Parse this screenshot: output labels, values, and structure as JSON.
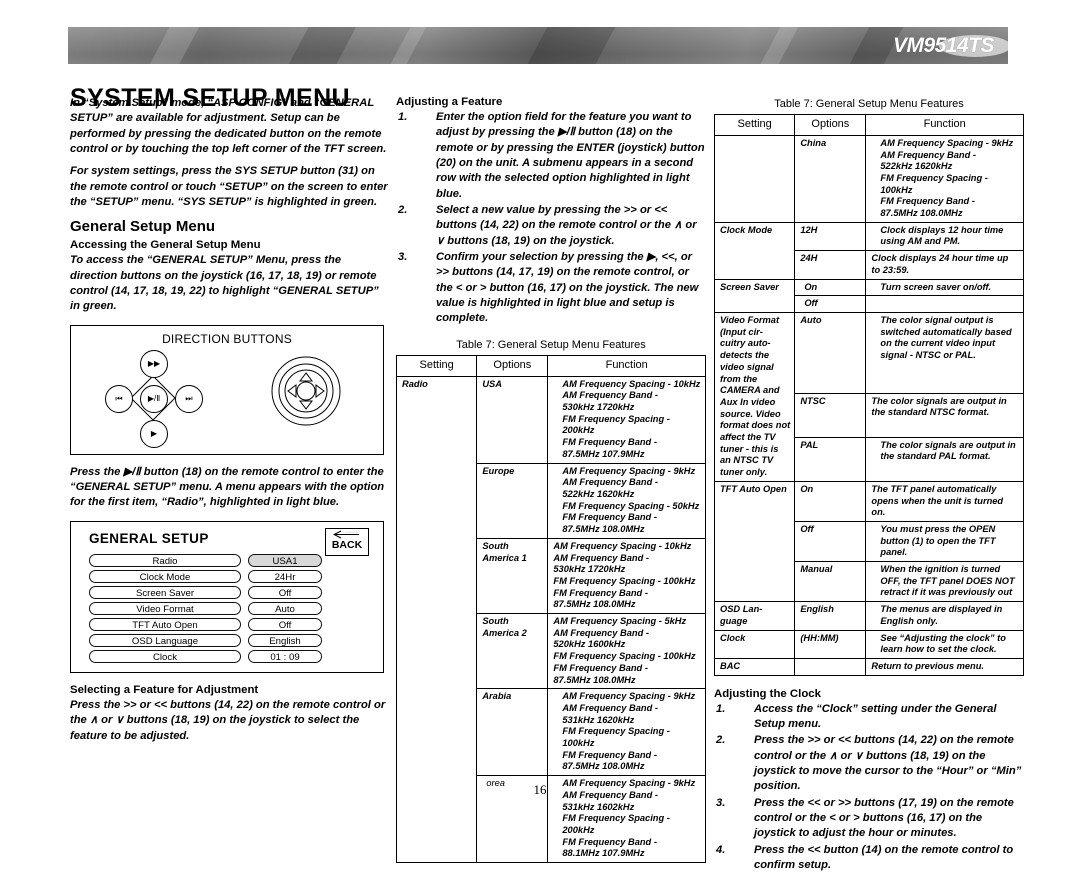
{
  "header": {
    "logo": "VM9514TS",
    "title": "SYSTEM SETUP MENU"
  },
  "left_column": {
    "intro_p1": "In “System Setup” mode, “ASP CONFIG” and “GENERAL SETUP” are available for adjustment. Setup can be performed by pressing the dedicated button on the remote control or by touching the top left corner of the TFT screen.",
    "intro_p2": "For system settings, press the SYS SETUP button (31) on the remote control or touch “SETUP” on the screen to enter the “SETUP” menu. “SYS SETUP” is highlighted in green.",
    "section_heading": "General Setup Menu",
    "accessing_heading": "Accessing the General Setup Menu",
    "accessing_body": "To access the “GENERAL SETUP” Menu, press the direction buttons on the joystick (16, 17, 18, 19) or remote control (14, 17, 18, 19, 22) to highlight “GENERAL SETUP” in green.",
    "figure_direction_caption": "DIRECTION BUTTONS",
    "dpad": {
      "up": "▶▶",
      "left": "⏮",
      "center": "▶/Ⅱ",
      "right": "⏭",
      "down": "▶"
    },
    "press_enter_body": "Press the ▶/Ⅱ button (18) on the remote control to enter the “GENERAL SETUP” menu. A menu appears with the option for the first item, “Radio”, highlighted in light blue.",
    "setup_screen": {
      "title": "GENERAL SETUP",
      "back_label": "BACK",
      "rows": [
        {
          "name": "Radio",
          "value": "USA1",
          "selected": true
        },
        {
          "name": "Clock  Mode",
          "value": "24Hr",
          "selected": false
        },
        {
          "name": "Screen Saver",
          "value": "Off",
          "selected": false
        },
        {
          "name": "Video Format",
          "value": "Auto",
          "selected": false
        },
        {
          "name": "TFT Auto Open",
          "value": "Off",
          "selected": false
        },
        {
          "name": "OSD Language",
          "value": "English",
          "selected": false
        },
        {
          "name": "Clock",
          "value": "01 :  09",
          "selected": false
        }
      ]
    },
    "selecting_heading": "Selecting a Feature for Adjustment",
    "selecting_body": "Press the >> or << buttons (14, 22) on the remote control or the ∧ or ∨ buttons (18, 19) on the joystick to select the feature to be adjusted."
  },
  "middle_column": {
    "adjusting_heading": "Adjusting a Feature",
    "steps": [
      {
        "num": "1.",
        "text": "Enter the option field for the feature you want to adjust by pressing the ▶/Ⅱ button (18) on the remote or by pressing the ENTER (joystick) button (20) on the unit. A submenu appears in a second row with the selected option highlighted in light blue."
      },
      {
        "num": "2.",
        "text": "Select a new value by pressing the >> or << buttons (14, 22) on the remote control or the ∧ or ∨ buttons (18, 19) on the joystick."
      },
      {
        "num": "3.",
        "text": "Confirm your selection by pressing the ▶, <<, or >> buttons (14, 17, 19) on the remote control, or the < or > button (16, 17) on the joystick. The new value is highlighted in light blue and setup is complete."
      }
    ],
    "table": {
      "caption": "Table 7: General Setup Menu Features",
      "columns": [
        "Setting",
        "Options",
        "Function"
      ],
      "rows": [
        {
          "setting": "Radio",
          "setting_rowspan": 6,
          "option": "USA",
          "function": "AM Frequency Spacing - 10kHz\nAM Frequency Band -\n530kHz 1720kHz\nFM Frequency Spacing - 200kHz\nFM Frequency Band -\n87.5MHz 107.9MHz",
          "indent": true
        },
        {
          "option": "Europe",
          "function": "AM Frequency Spacing - 9kHz\nAM Frequency Band -\n522kHz 1620kHz\nFM Frequency Spacing - 50kHz\nFM Frequency Band -\n87.5MHz 108.0MHz",
          "indent": true
        },
        {
          "option": "South\nAmerica 1",
          "function": "AM Frequency Spacing - 10kHz\nAM Frequency Band -\n530kHz 1720kHz\nFM Frequency Spacing - 100kHz\nFM Frequency Band -\n87.5MHz 108.0MHz",
          "indent": false
        },
        {
          "option": "South\nAmerica 2",
          "function": "AM Frequency Spacing - 5kHz\nAM Frequency Band -\n520kHz 1600kHz\nFM Frequency Spacing - 100kHz\nFM Frequency Band -\n87.5MHz 108.0MHz",
          "indent": false
        },
        {
          "option": "Arabia",
          "function": "AM Frequency Spacing - 9kHz\nAM Frequency Band -\n531kHz 1620kHz\nFM Frequency Spacing - 100kHz\nFM Frequency Band -\n87.5MHz 108.0MHz",
          "indent": true
        },
        {
          "option": "orea",
          "function": "AM Frequency Spacing - 9kHz\nAM Frequency Band -\n531kHz 1602kHz\nFM Frequency Spacing - 200kHz\nFM Frequency Band -\n88.1MHz 107.9MHz",
          "indent": true
        }
      ]
    }
  },
  "right_column": {
    "table": {
      "caption": "Table 7: General Setup Menu Features",
      "columns": [
        "Setting",
        "Options",
        "Function"
      ],
      "rows": [
        {
          "setting": "",
          "option": "China",
          "function": "AM Frequency Spacing - 9kHz\nAM Frequency Band -\n522kHz 1620kHz\nFM Frequency Spacing - 100kHz\nFM Frequency Band -\n87.5MHz 108.0MHz",
          "indent": true
        },
        {
          "setting": "Clock Mode",
          "setting_rowspan": 2,
          "option": "12H",
          "function": "Clock displays 12 hour time using AM and PM.",
          "indent": true
        },
        {
          "option": "24H",
          "function": "Clock displays 24 hour time up to 23:59.",
          "indent": false
        },
        {
          "setting": "Screen Saver",
          "setting_rowspan": 2,
          "option": "On",
          "function": "Turn screen saver on/off.",
          "indent": true
        },
        {
          "option": "Off",
          "function": "",
          "indent": false
        },
        {
          "setting": "Video Format (Input cir- cuitry auto- detects the video signal from the CAMERA and Aux In video source. Video format does not affect the TV tuner - this is an NTSC TV tuner only.",
          "setting_rowspan": 3,
          "option": "Auto",
          "function": "The color signal output is switched automatically based on the current video input signal - NTSC or PAL.",
          "indent": true
        },
        {
          "option": "NTSC",
          "function": "The color signals are output in the standard NTSC format.",
          "indent": false
        },
        {
          "option": "PAL",
          "function": "The color signals are output in the standard PAL format.",
          "indent": true
        },
        {
          "setting": "TFT Auto Open",
          "setting_rowspan": 3,
          "option": "On",
          "function": "The TFT panel automatically opens when the unit is turned on.",
          "indent": false
        },
        {
          "option": "Off",
          "function": "You must press the OPEN button (1) to open the TFT panel.",
          "indent": true
        },
        {
          "option": "Manual",
          "function": "When the ignition is turned OFF, the TFT panel DOES NOT retract if it was previously out",
          "indent": true
        },
        {
          "setting": "OSD Lan- guage",
          "option": "English",
          "function": "The menus are displayed in English only.",
          "indent": true
        },
        {
          "setting": "Clock",
          "option": "(HH:MM)",
          "function": "See “Adjusting the clock” to learn how to set the clock.",
          "indent": true
        },
        {
          "setting": "BAC",
          "option": "",
          "function": "Return to previous menu.",
          "indent": false
        }
      ]
    },
    "clock_heading": "Adjusting the Clock",
    "clock_steps": [
      {
        "num": "1.",
        "text": "Access the “Clock” setting under the General Setup menu."
      },
      {
        "num": "2.",
        "text": "Press the >> or << buttons (14, 22) on the remote control or the ∧ or ∨ buttons (18, 19) on the joystick to move the cursor to the “Hour” or “Min” position."
      },
      {
        "num": "3.",
        "text": "Press the << or >> buttons (17, 19) on the remote control or the < or > buttons (16, 17) on the joystick to adjust the hour or minutes."
      },
      {
        "num": "4.",
        "text": "Press the << button (14) on the remote control to confirm setup."
      }
    ]
  },
  "footer": {
    "page_number": "16"
  }
}
